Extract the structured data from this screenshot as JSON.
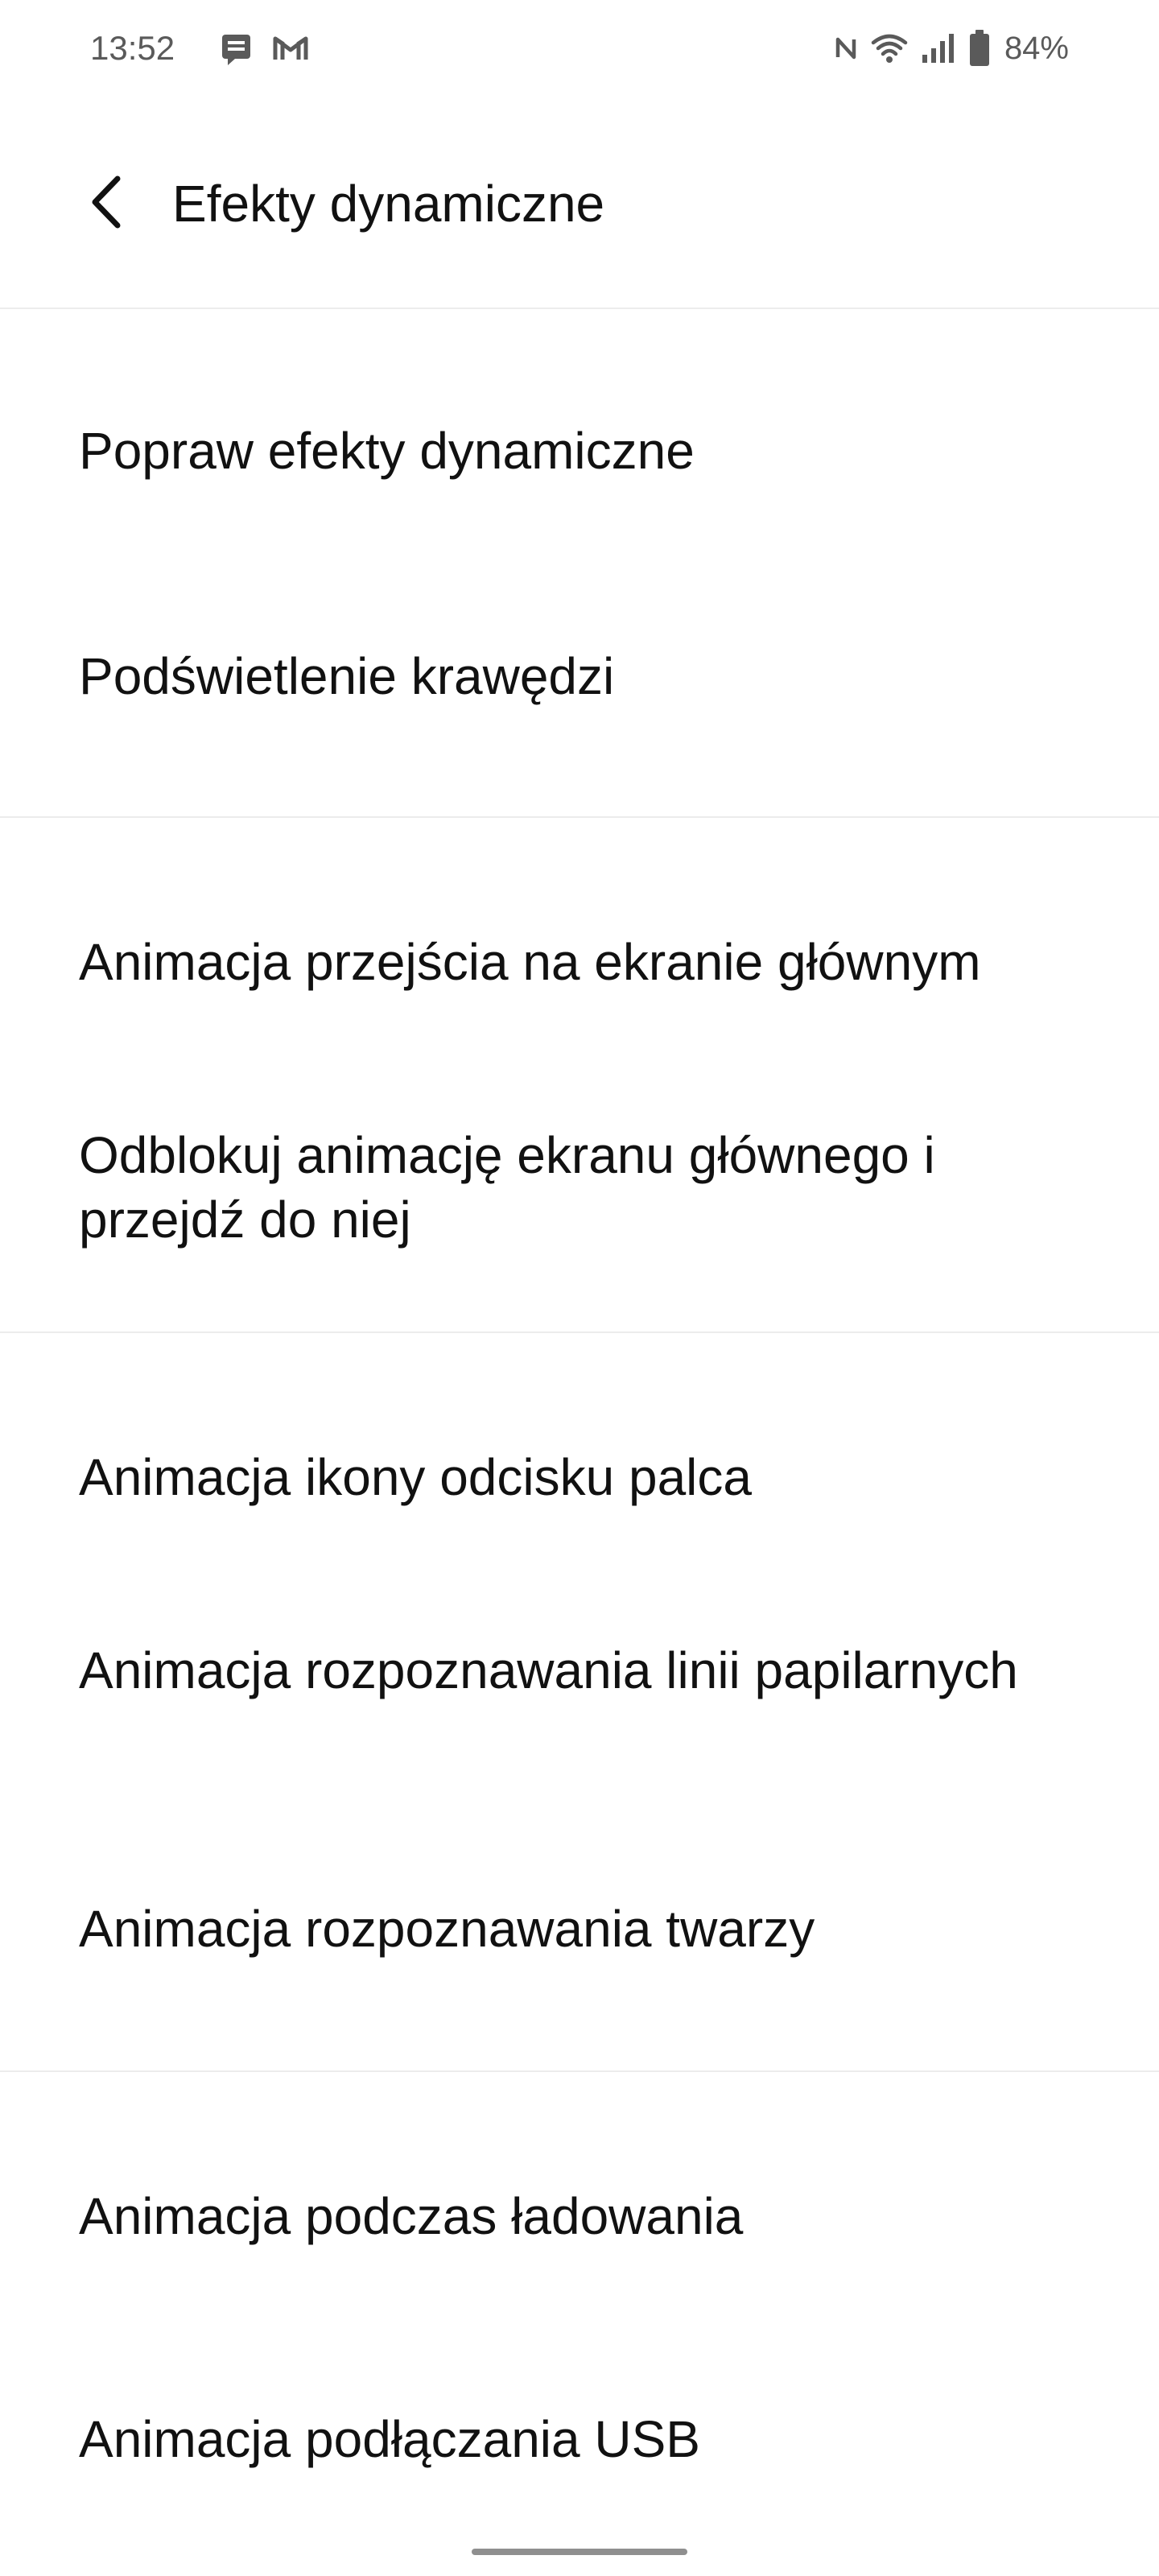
{
  "status_bar": {
    "time": "13:52",
    "battery": "84%",
    "icons": [
      "message-icon",
      "gmail-icon",
      "nfc-icon",
      "wifi-icon",
      "signal-icon",
      "battery-icon"
    ]
  },
  "header": {
    "title": "Efekty dynamiczne",
    "back_icon": "chevron-left-icon"
  },
  "sections": [
    {
      "items": [
        {
          "label": "Popraw efekty dynamiczne"
        },
        {
          "label": "Podświetlenie krawędzi"
        }
      ]
    },
    {
      "items": [
        {
          "label": "Animacja przejścia na ekranie głównym"
        },
        {
          "label": "Odblokuj animację ekranu głównego i przejdź do niej"
        }
      ]
    },
    {
      "items": [
        {
          "label": "Animacja ikony odcisku palca"
        },
        {
          "label": "Animacja rozpoznawania linii papilarnych"
        },
        {
          "label": "Animacja rozpoznawania twarzy"
        }
      ]
    },
    {
      "items": [
        {
          "label": "Animacja podczas ładowania"
        },
        {
          "label": "Animacja podłączania USB"
        }
      ]
    }
  ],
  "colors": {
    "background": "#ffffff",
    "text": "#111111",
    "status_text": "#5a5a5a",
    "divider": "#ececec",
    "gesture_bar": "#8f8f8f"
  }
}
